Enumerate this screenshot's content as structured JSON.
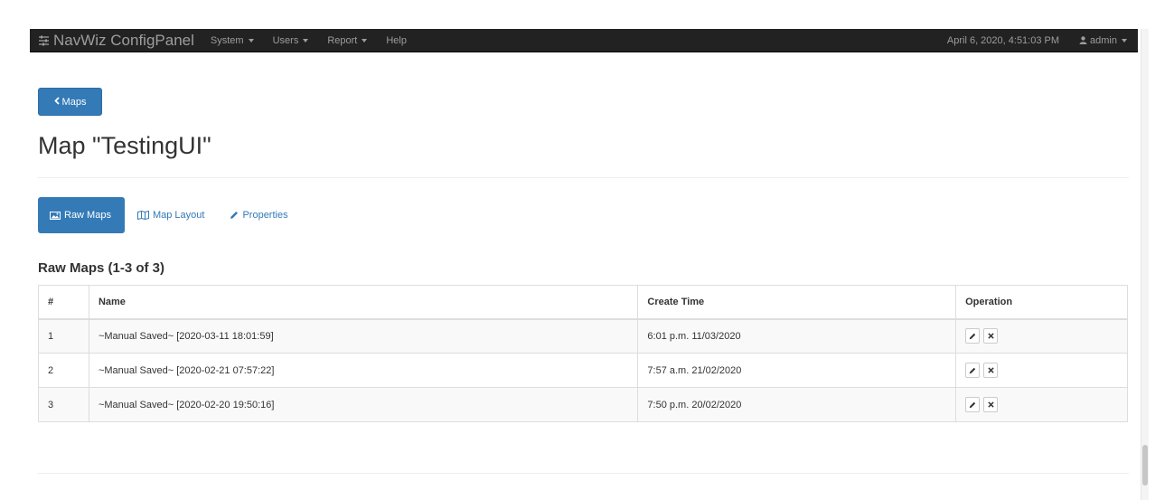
{
  "navbar": {
    "brand": "NavWiz ConfigPanel",
    "brand_icon": "sliders-icon",
    "menus": [
      "System",
      "Users",
      "Report"
    ],
    "help": "Help",
    "datetime": "April 6, 2020, 4:51:03 PM",
    "user": "admin",
    "user_icon": "user-icon"
  },
  "back_button": {
    "label": "Maps",
    "icon": "chevron-left-icon"
  },
  "title": "Map \"TestingUI\"",
  "tabs": {
    "raw_maps": "Raw Maps",
    "map_layout": "Map Layout",
    "properties": "Properties"
  },
  "section_heading": "Raw Maps (1-3 of 3)",
  "table": {
    "headers": {
      "num": "#",
      "name": "Name",
      "create_time": "Create Time",
      "operation": "Operation"
    },
    "rows": [
      {
        "num": "1",
        "name": "~Manual Saved~ [2020-03-11 18:01:59]",
        "create_time": "6:01 p.m. 11/03/2020"
      },
      {
        "num": "2",
        "name": "~Manual Saved~ [2020-02-21 07:57:22]",
        "create_time": "7:57 a.m. 21/02/2020"
      },
      {
        "num": "3",
        "name": "~Manual Saved~ [2020-02-20 19:50:16]",
        "create_time": "7:50 p.m. 20/02/2020"
      }
    ]
  },
  "colors": {
    "navbar_bg": "#222222",
    "nav_text": "#9d9d9d",
    "primary": "#337ab7",
    "table_border": "#dddddd",
    "stripe": "#f9f9f9"
  }
}
